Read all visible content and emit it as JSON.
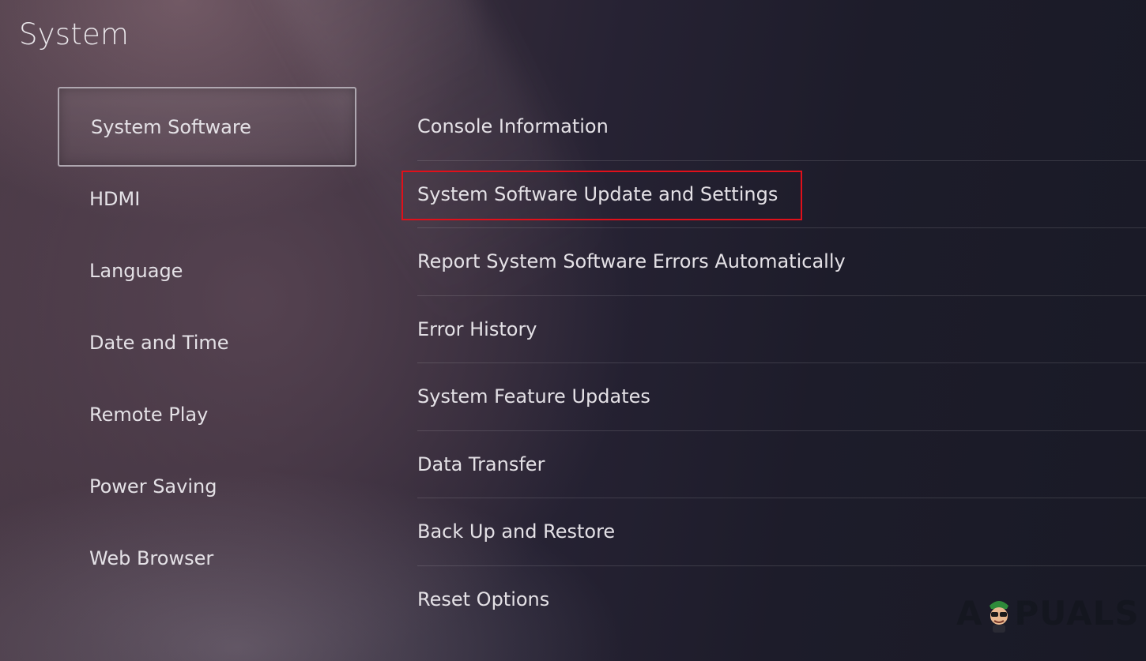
{
  "header": {
    "title": "System"
  },
  "left_menu": {
    "items": [
      {
        "label": "System Software",
        "selected": true
      },
      {
        "label": "HDMI"
      },
      {
        "label": "Language"
      },
      {
        "label": "Date and Time"
      },
      {
        "label": "Remote Play"
      },
      {
        "label": "Power Saving"
      },
      {
        "label": "Web Browser"
      }
    ]
  },
  "right_menu": {
    "items": [
      {
        "label": "Console Information"
      },
      {
        "label": "System Software Update and Settings",
        "highlighted": true
      },
      {
        "label": "Report System Software Errors Automatically"
      },
      {
        "label": "Error History"
      },
      {
        "label": "System Feature Updates"
      },
      {
        "label": "Data Transfer"
      },
      {
        "label": "Back Up and Restore"
      },
      {
        "label": "Reset Options"
      }
    ]
  },
  "annotation": {
    "highlight_color": "#e0101a"
  },
  "watermark": {
    "text_left": "A",
    "text_right": "PUALS",
    "mascot_icon": "appuals-mascot-icon"
  }
}
